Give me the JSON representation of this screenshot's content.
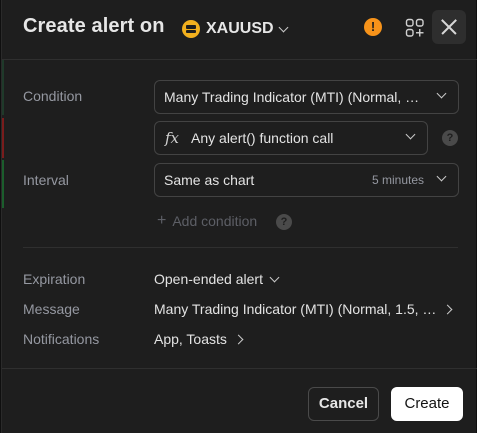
{
  "header": {
    "title": "Create alert on",
    "symbol": "XAUUSD",
    "warning_glyph": "!",
    "icons": [
      "warning-icon",
      "add-widget-icon",
      "close-icon"
    ]
  },
  "condition": {
    "label": "Condition",
    "indicator_value": "Many Trading Indicator (MTI) (Normal, 1.…",
    "trigger_icon_glyph": "fx",
    "trigger_value": "Any alert() function call",
    "help_glyph": "?"
  },
  "interval": {
    "label": "Interval",
    "value": "Same as chart",
    "hint": "5 minutes"
  },
  "add_condition": {
    "label": "Add condition",
    "help_glyph": "?"
  },
  "expiration": {
    "label": "Expiration",
    "value": "Open-ended alert"
  },
  "message": {
    "label": "Message",
    "value": "Many Trading Indicator (MTI) (Normal, 1.5, …"
  },
  "notifications": {
    "label": "Notifications",
    "value": "App, Toasts"
  },
  "footer": {
    "cancel_label": "Cancel",
    "create_label": "Create"
  },
  "colors": {
    "dialog_bg": "#1e1e1e",
    "warning": "#f7931a",
    "symbol_logo": "#f2b01e",
    "primary_button_bg": "#ffffff"
  }
}
